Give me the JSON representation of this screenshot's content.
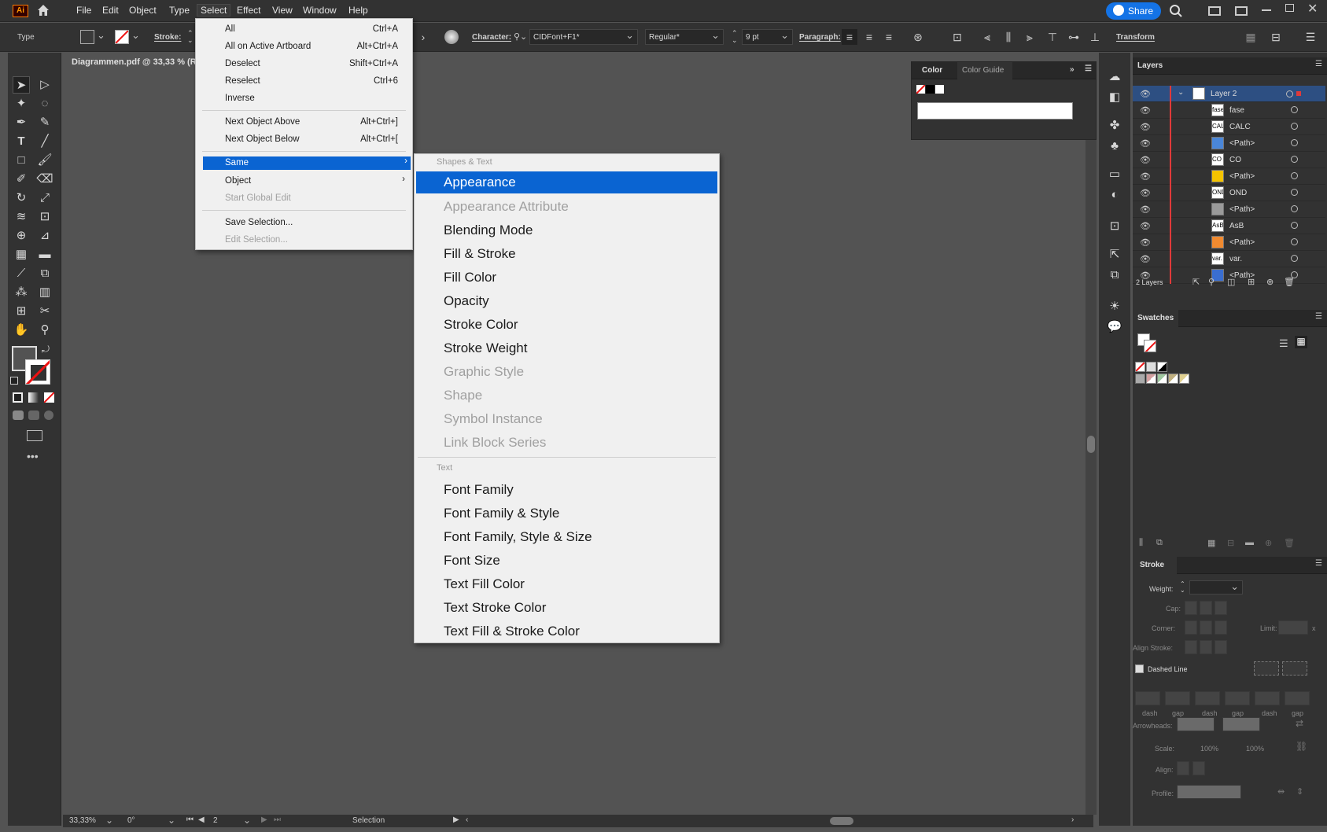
{
  "app": {
    "logo": "Ai"
  },
  "menubar": {
    "items": [
      "File",
      "Edit",
      "Object",
      "Type",
      "Select",
      "Effect",
      "View",
      "Window",
      "Help"
    ],
    "share_label": "Share"
  },
  "controlbar": {
    "type_label": "Type",
    "stroke_label": "Stroke:",
    "character_label": "Character:",
    "font_family": "CIDFont+F1*",
    "font_style": "Regular*",
    "font_size": "9 pt",
    "paragraph_label": "Paragraph:",
    "transform_label": "Transform"
  },
  "document": {
    "tab_title": "Diagrammen.pdf @ 33,33 % (R"
  },
  "select_menu": {
    "items": [
      {
        "label": "All",
        "shortcut": "Ctrl+A"
      },
      {
        "label": "All on Active Artboard",
        "shortcut": "Alt+Ctrl+A"
      },
      {
        "label": "Deselect",
        "shortcut": "Shift+Ctrl+A"
      },
      {
        "label": "Reselect",
        "shortcut": "Ctrl+6"
      },
      {
        "label": "Inverse",
        "shortcut": ""
      },
      {
        "label": "Next Object Above",
        "shortcut": "Alt+Ctrl+]"
      },
      {
        "label": "Next Object Below",
        "shortcut": "Alt+Ctrl+["
      },
      {
        "label": "Same",
        "shortcut": ""
      },
      {
        "label": "Object",
        "shortcut": ""
      },
      {
        "label": "Start Global Edit",
        "shortcut": ""
      },
      {
        "label": "Save Selection...",
        "shortcut": ""
      },
      {
        "label": "Edit Selection...",
        "shortcut": ""
      }
    ]
  },
  "same_submenu": {
    "header_shapes": "Shapes & Text",
    "shapes": [
      "Appearance",
      "Appearance Attribute",
      "Blending Mode",
      "Fill & Stroke",
      "Fill Color",
      "Opacity",
      "Stroke Color",
      "Stroke Weight",
      "Graphic Style",
      "Shape",
      "Symbol Instance",
      "Link Block Series"
    ],
    "header_text": "Text",
    "text": [
      "Font Family",
      "Font Family & Style",
      "Font Family, Style & Size",
      "Font Size",
      "Text Fill Color",
      "Text Stroke Color",
      "Text Fill & Stroke Color"
    ]
  },
  "color_panel": {
    "tab_color": "Color",
    "tab_guide": "Color Guide"
  },
  "layers_panel": {
    "title": "Layers",
    "layer_name": "Layer 2",
    "rows": [
      {
        "thumb": "fase",
        "name": "fase",
        "color": "#ffffff"
      },
      {
        "thumb": "CALC",
        "name": "CALC",
        "color": "#ffffff"
      },
      {
        "thumb": "",
        "name": "<Path>",
        "color": "#4a86d8"
      },
      {
        "thumb": "CO",
        "name": "CO",
        "color": "#ffffff"
      },
      {
        "thumb": "",
        "name": "<Path>",
        "color": "#f5c400"
      },
      {
        "thumb": "OND",
        "name": "OND",
        "color": "#ffffff"
      },
      {
        "thumb": "",
        "name": "<Path>",
        "color": "#9a9a9a"
      },
      {
        "thumb": "AsB",
        "name": "AsB",
        "color": "#ffffff"
      },
      {
        "thumb": "",
        "name": "<Path>",
        "color": "#f08a30"
      },
      {
        "thumb": "var.",
        "name": "var.",
        "color": "#ffffff"
      },
      {
        "thumb": "",
        "name": "<Path>",
        "color": "#3a6ed0"
      }
    ],
    "count": "2 Layers"
  },
  "swatches_panel": {
    "title": "Swatches"
  },
  "stroke_panel": {
    "title": "Stroke",
    "weight_label": "Weight:",
    "cap_label": "Cap:",
    "corner_label": "Corner:",
    "limit_label": "Limit:",
    "limit_x": "x",
    "align_label": "Align Stroke:",
    "dashed_label": "Dashed Line",
    "dash_labels": [
      "dash",
      "gap",
      "dash",
      "gap",
      "dash",
      "gap"
    ],
    "arrowheads_label": "Arrowheads:",
    "scale_label": "Scale:",
    "scale1": "100%",
    "scale2": "100%",
    "align2_label": "Align:",
    "profile_label": "Profile:"
  },
  "statusbar": {
    "zoom": "33,33%",
    "rotation": "0°",
    "artboard": "2",
    "tool": "Selection"
  }
}
